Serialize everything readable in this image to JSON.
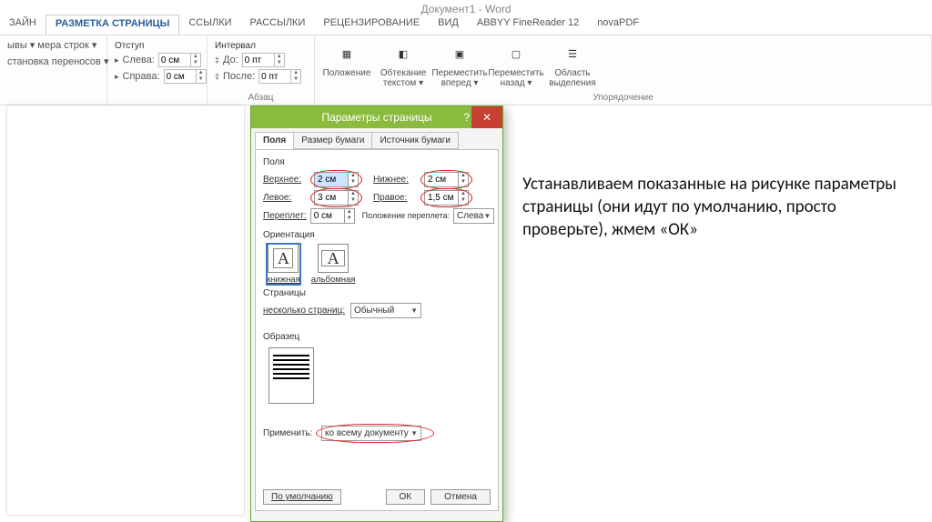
{
  "title": "Документ1 - Word",
  "tabs": [
    "ЗАЙН",
    "РАЗМЕТКА СТРАНИЦЫ",
    "ССЫЛКИ",
    "РАССЫЛКИ",
    "РЕЦЕНЗИРОВАНИЕ",
    "ВИД",
    "ABBYY FineReader 12",
    "novaPDF"
  ],
  "ribbon": {
    "group1": {
      "items": [
        "ывы ▾",
        "мера строк ▾",
        "становка переносов ▾"
      ]
    },
    "indent": {
      "title": "Отступ",
      "left_lbl": "Слева:",
      "left_val": "0 см",
      "right_lbl": "Справа:",
      "right_val": "0 см"
    },
    "interval": {
      "title": "Интервал",
      "before_lbl": "До:",
      "before_val": "0 пт",
      "after_lbl": "После:",
      "after_val": "0 пт"
    },
    "group_para": "Абзац",
    "arrange": {
      "pos": "Положение",
      "wrap": "Обтекание текстом ▾",
      "fwd": "Переместить вперед ▾",
      "back": "Переместить назад ▾",
      "pane": "Область выделения"
    },
    "group_arr": "Упорядочение"
  },
  "dialog": {
    "title": "Параметры страницы",
    "help": "?",
    "close": "✕",
    "tabs": [
      "Поля",
      "Размер бумаги",
      "Источник бумаги"
    ],
    "margins": {
      "section": "Поля",
      "top_lbl": "Верхнее:",
      "top_val": "2 см",
      "bottom_lbl": "Нижнее:",
      "bottom_val": "2 см",
      "left_lbl": "Левое:",
      "left_val": "3 см",
      "right_lbl": "Правое:",
      "right_val": "1,5 см",
      "gutter_lbl": "Переплет:",
      "gutter_val": "0 см",
      "gutter_pos_lbl": "Положение переплета:",
      "gutter_pos_val": "Слева"
    },
    "orient": {
      "section": "Ориентация",
      "portrait": "книжная",
      "landscape": "альбомная"
    },
    "pages": {
      "section": "Страницы",
      "multi_lbl": "несколько страниц:",
      "multi_val": "Обычный"
    },
    "sample": "Образец",
    "apply": {
      "lbl": "Применить:",
      "val": "ко всему документу"
    },
    "default_btn": "По умолчанию",
    "ok": "ОК",
    "cancel": "Отмена"
  },
  "instruction": "Устанавливаем показанные на рисунке параметры страницы (они идут по умолчанию, просто проверьте), жмем «ОК»"
}
